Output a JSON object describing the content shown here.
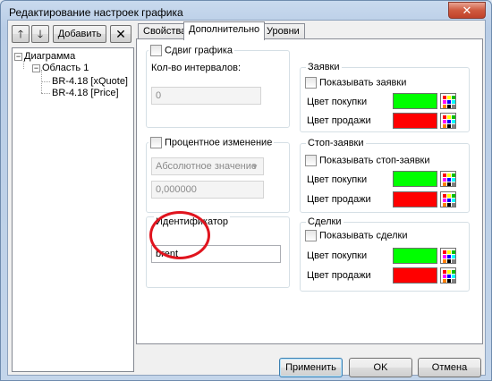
{
  "window": {
    "title": "Редактирование настроек графика",
    "close_label": "✕"
  },
  "toolbar": {
    "up_label": "🡑",
    "down_label": "🡓",
    "add_label": "Добавить",
    "delete_label": "✕"
  },
  "tree": {
    "root": "Диаграмма",
    "area": "Область 1",
    "items": [
      "BR-4.18 [xQuote]",
      "BR-4.18 [Price]"
    ]
  },
  "tabs": [
    {
      "label": "Свойства",
      "active": false
    },
    {
      "label": "Дополнительно",
      "active": true
    },
    {
      "label": "Уровни",
      "active": false
    }
  ],
  "shift": {
    "checkbox_label": "Сдвиг графика",
    "intervals_label": "Кол-во интервалов:",
    "intervals_value": "0"
  },
  "percent": {
    "checkbox_label": "Процентное изменение",
    "mode_value": "Абсолютное значение",
    "number_value": "0,000000"
  },
  "identifier": {
    "legend": "Идентификатор",
    "value": "brent"
  },
  "orders": {
    "legend": "Заявки",
    "show_label": "Показывать заявки",
    "buy_label": "Цвет покупки",
    "sell_label": "Цвет продажи"
  },
  "stop_orders": {
    "legend": "Стоп-заявки",
    "show_label": "Показывать стоп-заявки",
    "buy_label": "Цвет покупки",
    "sell_label": "Цвет продажи"
  },
  "trades": {
    "legend": "Сделки",
    "show_label": "Показывать сделки",
    "buy_label": "Цвет покупки",
    "sell_label": "Цвет продажи"
  },
  "colors": {
    "buy": "#00ff00",
    "sell": "#ff0000",
    "annotation": "#e0141e",
    "picker_grid": [
      "#ff0000",
      "#ffff00",
      "#00c000",
      "#ff00ff",
      "#0000ff",
      "#00ffff",
      "#ff8000",
      "#000000",
      "#808080"
    ]
  },
  "buttons": {
    "apply": "Применить",
    "ok": "OK",
    "cancel": "Отмена"
  }
}
